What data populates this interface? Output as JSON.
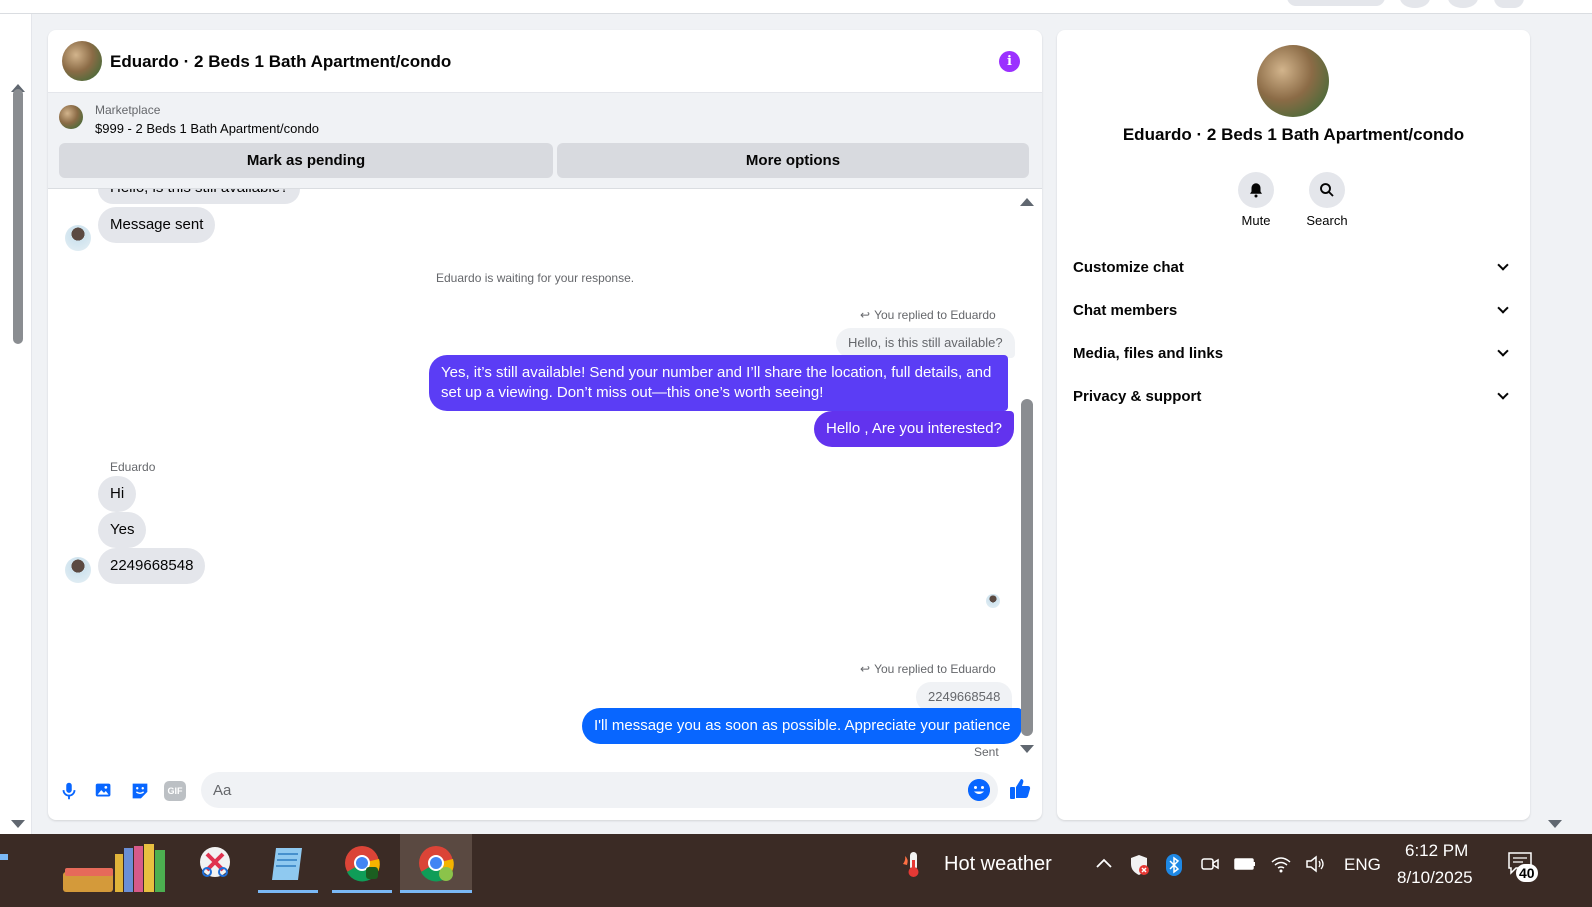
{
  "chat": {
    "title": "Eduardo · 2 Beds 1 Bath Apartment/condo",
    "info_glyph": "i",
    "marketplace_label": "Marketplace",
    "listing": "$999 - 2 Beds 1 Bath Apartment/condo",
    "mark_pending_label": "Mark as pending",
    "more_options_label": "More options",
    "messages": {
      "partial_top": "Hello, is this still available?",
      "message_sent": "Message sent",
      "waiting": "Eduardo is waiting for your response.",
      "reply1_label": "You replied to Eduardo",
      "reply1_quote": "Hello, is this still available?",
      "reply1_text_line1": "Yes, it’s still available! Send your number and I’ll share the location, full details, and",
      "reply1_text_line2": "set up a viewing. Don’t miss out—this one’s worth seeing!",
      "out_interested": "Hello , Are you interested?",
      "sender_name": "Eduardo",
      "in_hi": "Hi",
      "in_yes": "Yes",
      "in_number": "2249668548",
      "reply2_label": "You replied to Eduardo",
      "reply2_quote": "2249668548",
      "reply2_text": "I'll message you as soon as possible. Appreciate your patience",
      "status": "Sent"
    },
    "composer": {
      "placeholder": "Aa",
      "gif_label": "GIF"
    },
    "colors": {
      "accent": "#0866ff",
      "purple_bubble": "#5b3df5",
      "info_purple": "#9b30ff"
    }
  },
  "info_panel": {
    "name": "Eduardo · 2 Beds 1 Bath Apartment/condo",
    "mute_label": "Mute",
    "search_label": "Search",
    "sections": [
      "Customize chat",
      "Chat members",
      "Media, files and links",
      "Privacy & support"
    ]
  },
  "taskbar": {
    "weather": "Hot weather",
    "language": "ENG",
    "time": "6:12 PM",
    "date": "8/10/2025",
    "notification_count": "40"
  }
}
